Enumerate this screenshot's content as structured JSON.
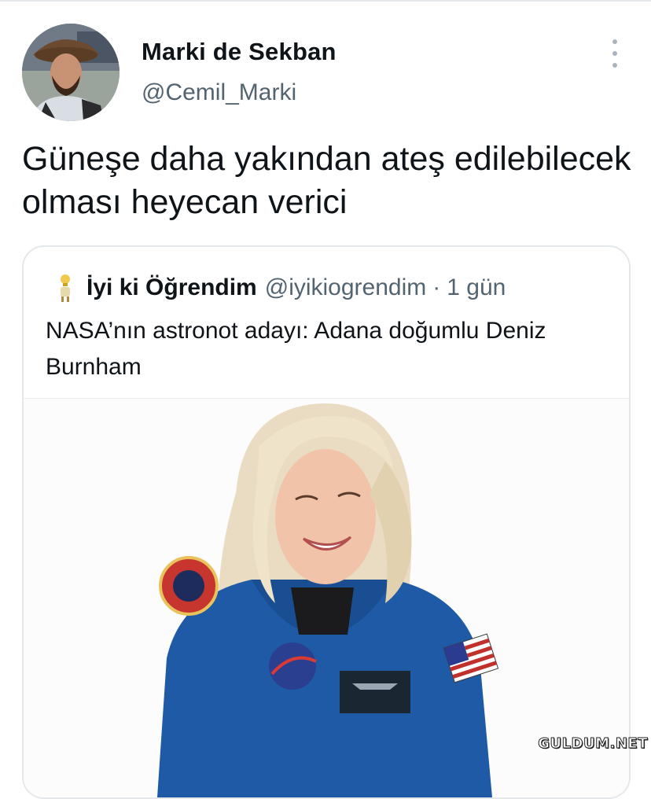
{
  "tweet": {
    "display_name": "Marki de Sekban",
    "handle": "@Cemil_Marki",
    "text": "Güneşe daha yakından ateş edilebilecek olması heyecan verici",
    "more_icon": "more-vertical-icon"
  },
  "quoted_tweet": {
    "account_icon": "lightbulb-person-icon",
    "display_name": "İyi ki Öğrendim",
    "handle": "@iyikiogrendim",
    "separator": "·",
    "time": "1 gün",
    "text": "NASA’nın astronot adayı: Adana doğumlu Deniz Burnham"
  },
  "watermark": "GULDUM.NET",
  "colors": {
    "text_primary": "#0f1419",
    "text_secondary": "#536471",
    "border": "#e4e8eb",
    "flight_suit": "#1f5aa6"
  }
}
